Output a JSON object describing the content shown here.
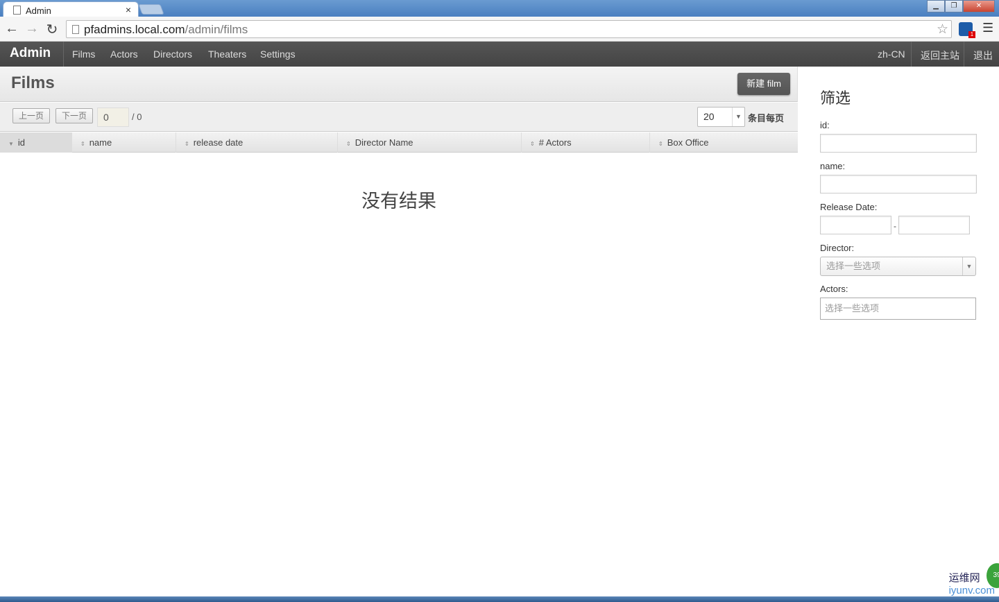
{
  "browser": {
    "tab_title": "Admin",
    "tab_close": "×",
    "url_host": "pfadmins.local.com",
    "url_path": "/admin/films",
    "window_min": "▁",
    "window_max": "❐",
    "window_close": "✕"
  },
  "navbar": {
    "brand": "Admin",
    "items": [
      {
        "label": "Films"
      },
      {
        "label": "Actors"
      },
      {
        "label": "Directors"
      },
      {
        "label": "Theaters"
      },
      {
        "label": "Settings"
      }
    ],
    "locale": "zh-CN",
    "back_to_site": "返回主站",
    "logout": "退出"
  },
  "main": {
    "title": "Films",
    "new_button": "新建 film",
    "pager": {
      "prev": "上一页",
      "next": "下一页",
      "current_page": "0",
      "total": "/ 0",
      "per_page": "20",
      "per_page_label": "条目每页"
    },
    "columns": [
      {
        "label": "id"
      },
      {
        "label": "name"
      },
      {
        "label": "release date"
      },
      {
        "label": "Director Name"
      },
      {
        "label": "# Actors"
      },
      {
        "label": "Box Office"
      }
    ],
    "no_results": "没有结果"
  },
  "filter": {
    "title": "筛选",
    "id_label": "id:",
    "name_label": "name:",
    "release_date_label": "Release Date:",
    "date_separator": "-",
    "director_label": "Director:",
    "director_placeholder": "选择一些选项",
    "actors_label": "Actors:",
    "actors_placeholder": "选择一些选项"
  },
  "watermark": {
    "line1": "运维网",
    "line2": "iyunv.com",
    "badge": "39"
  },
  "colors": {
    "navbar_bg": "#4a4a4a",
    "button_bg": "#5a5a5a",
    "titlebar_bg": "#4a7fc0"
  }
}
